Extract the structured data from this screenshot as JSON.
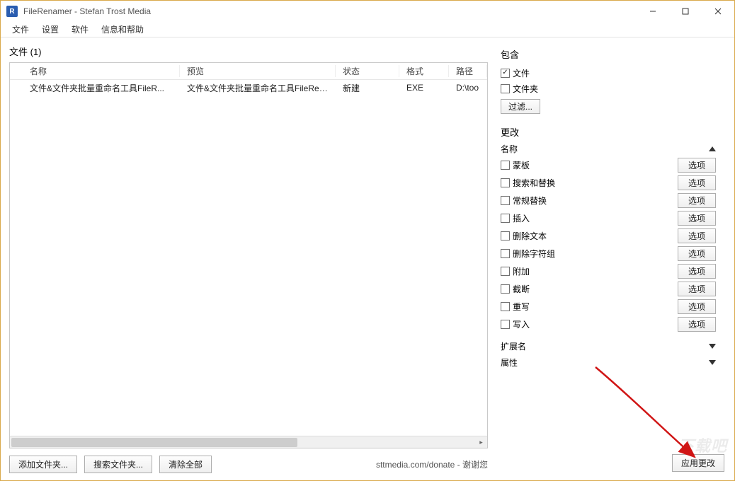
{
  "window": {
    "title": "FileRenamer - Stefan Trost Media"
  },
  "menu": {
    "file": "文件",
    "settings": "设置",
    "software": "软件",
    "help": "信息和帮助"
  },
  "left": {
    "title": "文件 (1)",
    "headers": {
      "name": "名称",
      "preview": "预览",
      "status": "状态",
      "format": "格式",
      "path": "路径"
    },
    "rows": [
      {
        "name": "文件&文件夹批量重命名工具FileR...",
        "preview": "文件&文件夹批量重命名工具FileRen...",
        "status": "新建",
        "format": "EXE",
        "path": "D:\\too"
      }
    ],
    "buttons": {
      "add": "添加文件夹...",
      "search": "搜索文件夹...",
      "clear": "清除全部"
    },
    "footer": "sttmedia.com/donate - 谢谢您"
  },
  "right": {
    "include": {
      "title": "包含",
      "files": "文件",
      "files_checked": true,
      "folders": "文件夹",
      "folders_checked": false,
      "filter": "过滤..."
    },
    "change": {
      "title": "更改",
      "name_group": "名称",
      "options_label": "选项",
      "items": [
        {
          "label": "蒙板"
        },
        {
          "label": "搜索和替换"
        },
        {
          "label": "常规替换"
        },
        {
          "label": "插入"
        },
        {
          "label": "删除文本"
        },
        {
          "label": "删除字符组"
        },
        {
          "label": "附加"
        },
        {
          "label": "截断"
        },
        {
          "label": "重写"
        },
        {
          "label": "写入"
        }
      ],
      "ext_group": "扩展名",
      "attr_group": "属性"
    },
    "apply": "应用更改"
  }
}
